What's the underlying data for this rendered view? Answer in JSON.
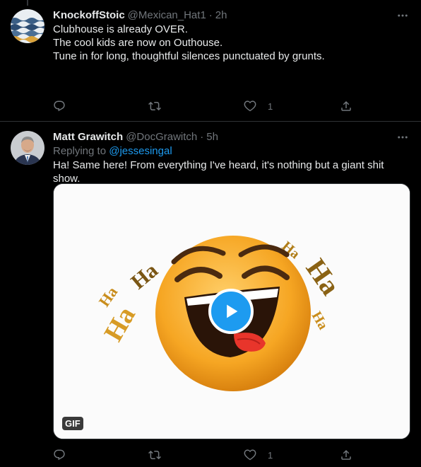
{
  "tweets": [
    {
      "display_name": "KnockoffStoic",
      "handle": "@Mexican_Hat1",
      "time": "2h",
      "paragraphs": [
        "Clubhouse is already OVER.",
        "The cool kids are now on Outhouse.",
        "Tune in for long, thoughtful silences punctuated by grunts."
      ],
      "reply_count": "",
      "retweet_count": "",
      "like_count": "1"
    },
    {
      "display_name": "Matt Grawitch",
      "handle": "@DocGrawitch",
      "time": "5h",
      "replying_prefix": "Replying to",
      "replying_to": "@jessesingal",
      "text": "Ha! Same here! From everything I've heard, it's nothing but a giant shit show.",
      "media": {
        "badge": "GIF",
        "ha_left": [
          "Ha",
          "Ha",
          "Ha"
        ],
        "ha_right": [
          "Ha",
          "Ha",
          "Ha"
        ]
      },
      "reply_count": "",
      "retweet_count": "",
      "like_count": "1"
    }
  ],
  "separator_dot": "·",
  "colors": {
    "background": "#000000",
    "text": "#e7e9ea",
    "muted": "#71767b",
    "link": "#1d9bf0",
    "border": "#2f3336"
  },
  "icons": [
    "more-icon",
    "reply-icon",
    "retweet-icon",
    "like-icon",
    "share-icon",
    "play-icon"
  ]
}
